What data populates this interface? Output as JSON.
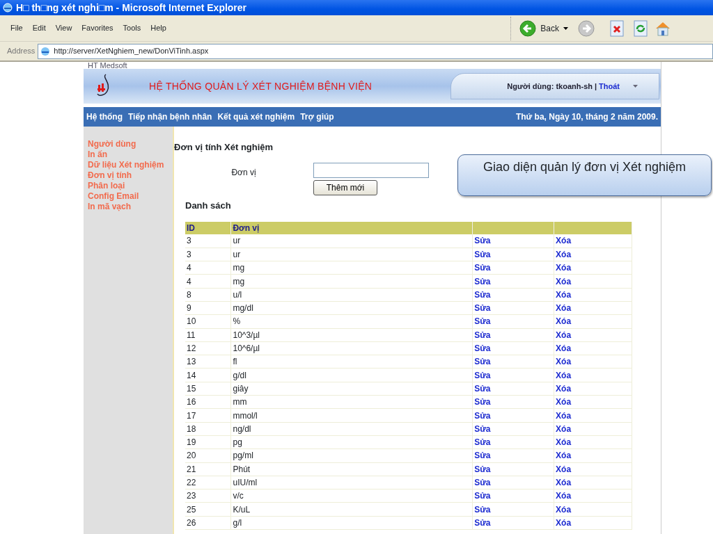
{
  "window": {
    "title": "H□ th□ng xét nghi□m - Microsoft Internet Explorer"
  },
  "menu": [
    "File",
    "Edit",
    "View",
    "Favorites",
    "Tools",
    "Help"
  ],
  "toolbar": {
    "back_label": "Back"
  },
  "address": {
    "label": "Address",
    "url": "http://server/XetNghiem_new/DonViTinh.aspx"
  },
  "page": {
    "brand": "HT Medsoft",
    "banner_title": "HỆ THỐNG QUẢN LÝ XÉT NGHIỆM BỆNH VIỆN",
    "user": {
      "label": "Người dùng: tkoanh-sh",
      "separator": "|",
      "logout": "Thoát"
    },
    "nav": [
      "Hệ thống",
      "Tiếp nhận bệnh nhân",
      "Kết quả xét nghiệm",
      "Trợ giúp"
    ],
    "date": "Thứ ba, Ngày 10, tháng 2 năm 2009.",
    "sidebar": [
      "Người dùng",
      "In ấn",
      "Dữ liệu Xét nghiệm",
      "Đơn vị tính",
      "Phân loại",
      "Config Email",
      "In mã vạch"
    ],
    "heading": "Đơn vị tính Xét nghiệm",
    "field_label": "Đơn vị",
    "add_button": "Thêm mới",
    "list_heading": "Danh sách",
    "table": {
      "columns": [
        "ID",
        "Đơn vị"
      ],
      "rows": [
        {
          "id": "3",
          "unit": "ur",
          "edit": "Sửa",
          "delete": "Xóa"
        },
        {
          "id": "3",
          "unit": "ur",
          "edit": "Sửa",
          "delete": "Xóa"
        },
        {
          "id": "4",
          "unit": "mg",
          "edit": "Sửa",
          "delete": "Xóa"
        },
        {
          "id": "4",
          "unit": "mg",
          "edit": "Sửa",
          "delete": "Xóa"
        },
        {
          "id": "8",
          "unit": "u/l",
          "edit": "Sửa",
          "delete": "Xóa"
        },
        {
          "id": "9",
          "unit": "mg/dl",
          "edit": "Sửa",
          "delete": "Xóa"
        },
        {
          "id": "10",
          "unit": "%",
          "edit": "Sửa",
          "delete": "Xóa"
        },
        {
          "id": "11",
          "unit": "10^3/µl",
          "edit": "Sửa",
          "delete": "Xóa"
        },
        {
          "id": "12",
          "unit": "10^6/µl",
          "edit": "Sửa",
          "delete": "Xóa"
        },
        {
          "id": "13",
          "unit": "fl",
          "edit": "Sửa",
          "delete": "Xóa"
        },
        {
          "id": "14",
          "unit": "g/dl",
          "edit": "Sửa",
          "delete": "Xóa"
        },
        {
          "id": "15",
          "unit": "giây",
          "edit": "Sửa",
          "delete": "Xóa"
        },
        {
          "id": "16",
          "unit": "mm",
          "edit": "Sửa",
          "delete": "Xóa"
        },
        {
          "id": "17",
          "unit": "mmol/l",
          "edit": "Sửa",
          "delete": "Xóa"
        },
        {
          "id": "18",
          "unit": "ng/dl",
          "edit": "Sửa",
          "delete": "Xóa"
        },
        {
          "id": "19",
          "unit": "pg",
          "edit": "Sửa",
          "delete": "Xóa"
        },
        {
          "id": "20",
          "unit": "pg/ml",
          "edit": "Sửa",
          "delete": "Xóa"
        },
        {
          "id": "21",
          "unit": "Phút",
          "edit": "Sửa",
          "delete": "Xóa"
        },
        {
          "id": "22",
          "unit": "uIU/ml",
          "edit": "Sửa",
          "delete": "Xóa"
        },
        {
          "id": "23",
          "unit": "v/c",
          "edit": "Sửa",
          "delete": "Xóa"
        },
        {
          "id": "25",
          "unit": "K/uL",
          "edit": "Sửa",
          "delete": "Xóa"
        },
        {
          "id": "26",
          "unit": "g/l",
          "edit": "Sửa",
          "delete": "Xóa"
        }
      ]
    }
  },
  "callout": "Giao diện quản lý đơn vị Xét nghiệm"
}
